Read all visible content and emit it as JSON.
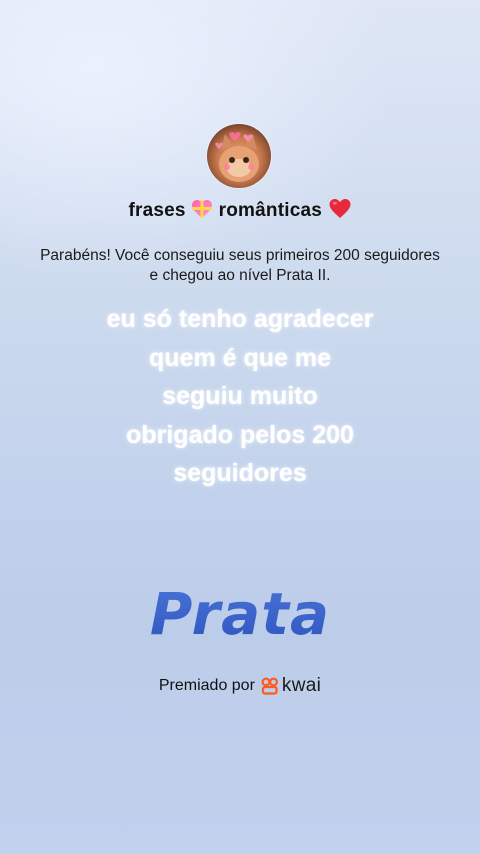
{
  "profile": {
    "username_part1": "frases",
    "username_part2": "românticas",
    "emoji1": "heart-with-ribbon",
    "emoji2": "red-heart"
  },
  "message": {
    "congrats": "Parabéns! Você conseguiu seus primeiros 200 seguidores e chegou ao nível Prata II."
  },
  "overlay": {
    "lines": [
      "eu só tenho agradecer",
      "quem é que me",
      "seguiu muito",
      "obrigado pelos 200",
      "seguidores"
    ]
  },
  "badge": {
    "level": "Prata"
  },
  "award": {
    "label": "Premiado por",
    "brand": "kwai",
    "brand_color": "#ff5a1f"
  },
  "colors": {
    "level_blue": "#3d63c9",
    "overlay_text": "#ffffff"
  }
}
